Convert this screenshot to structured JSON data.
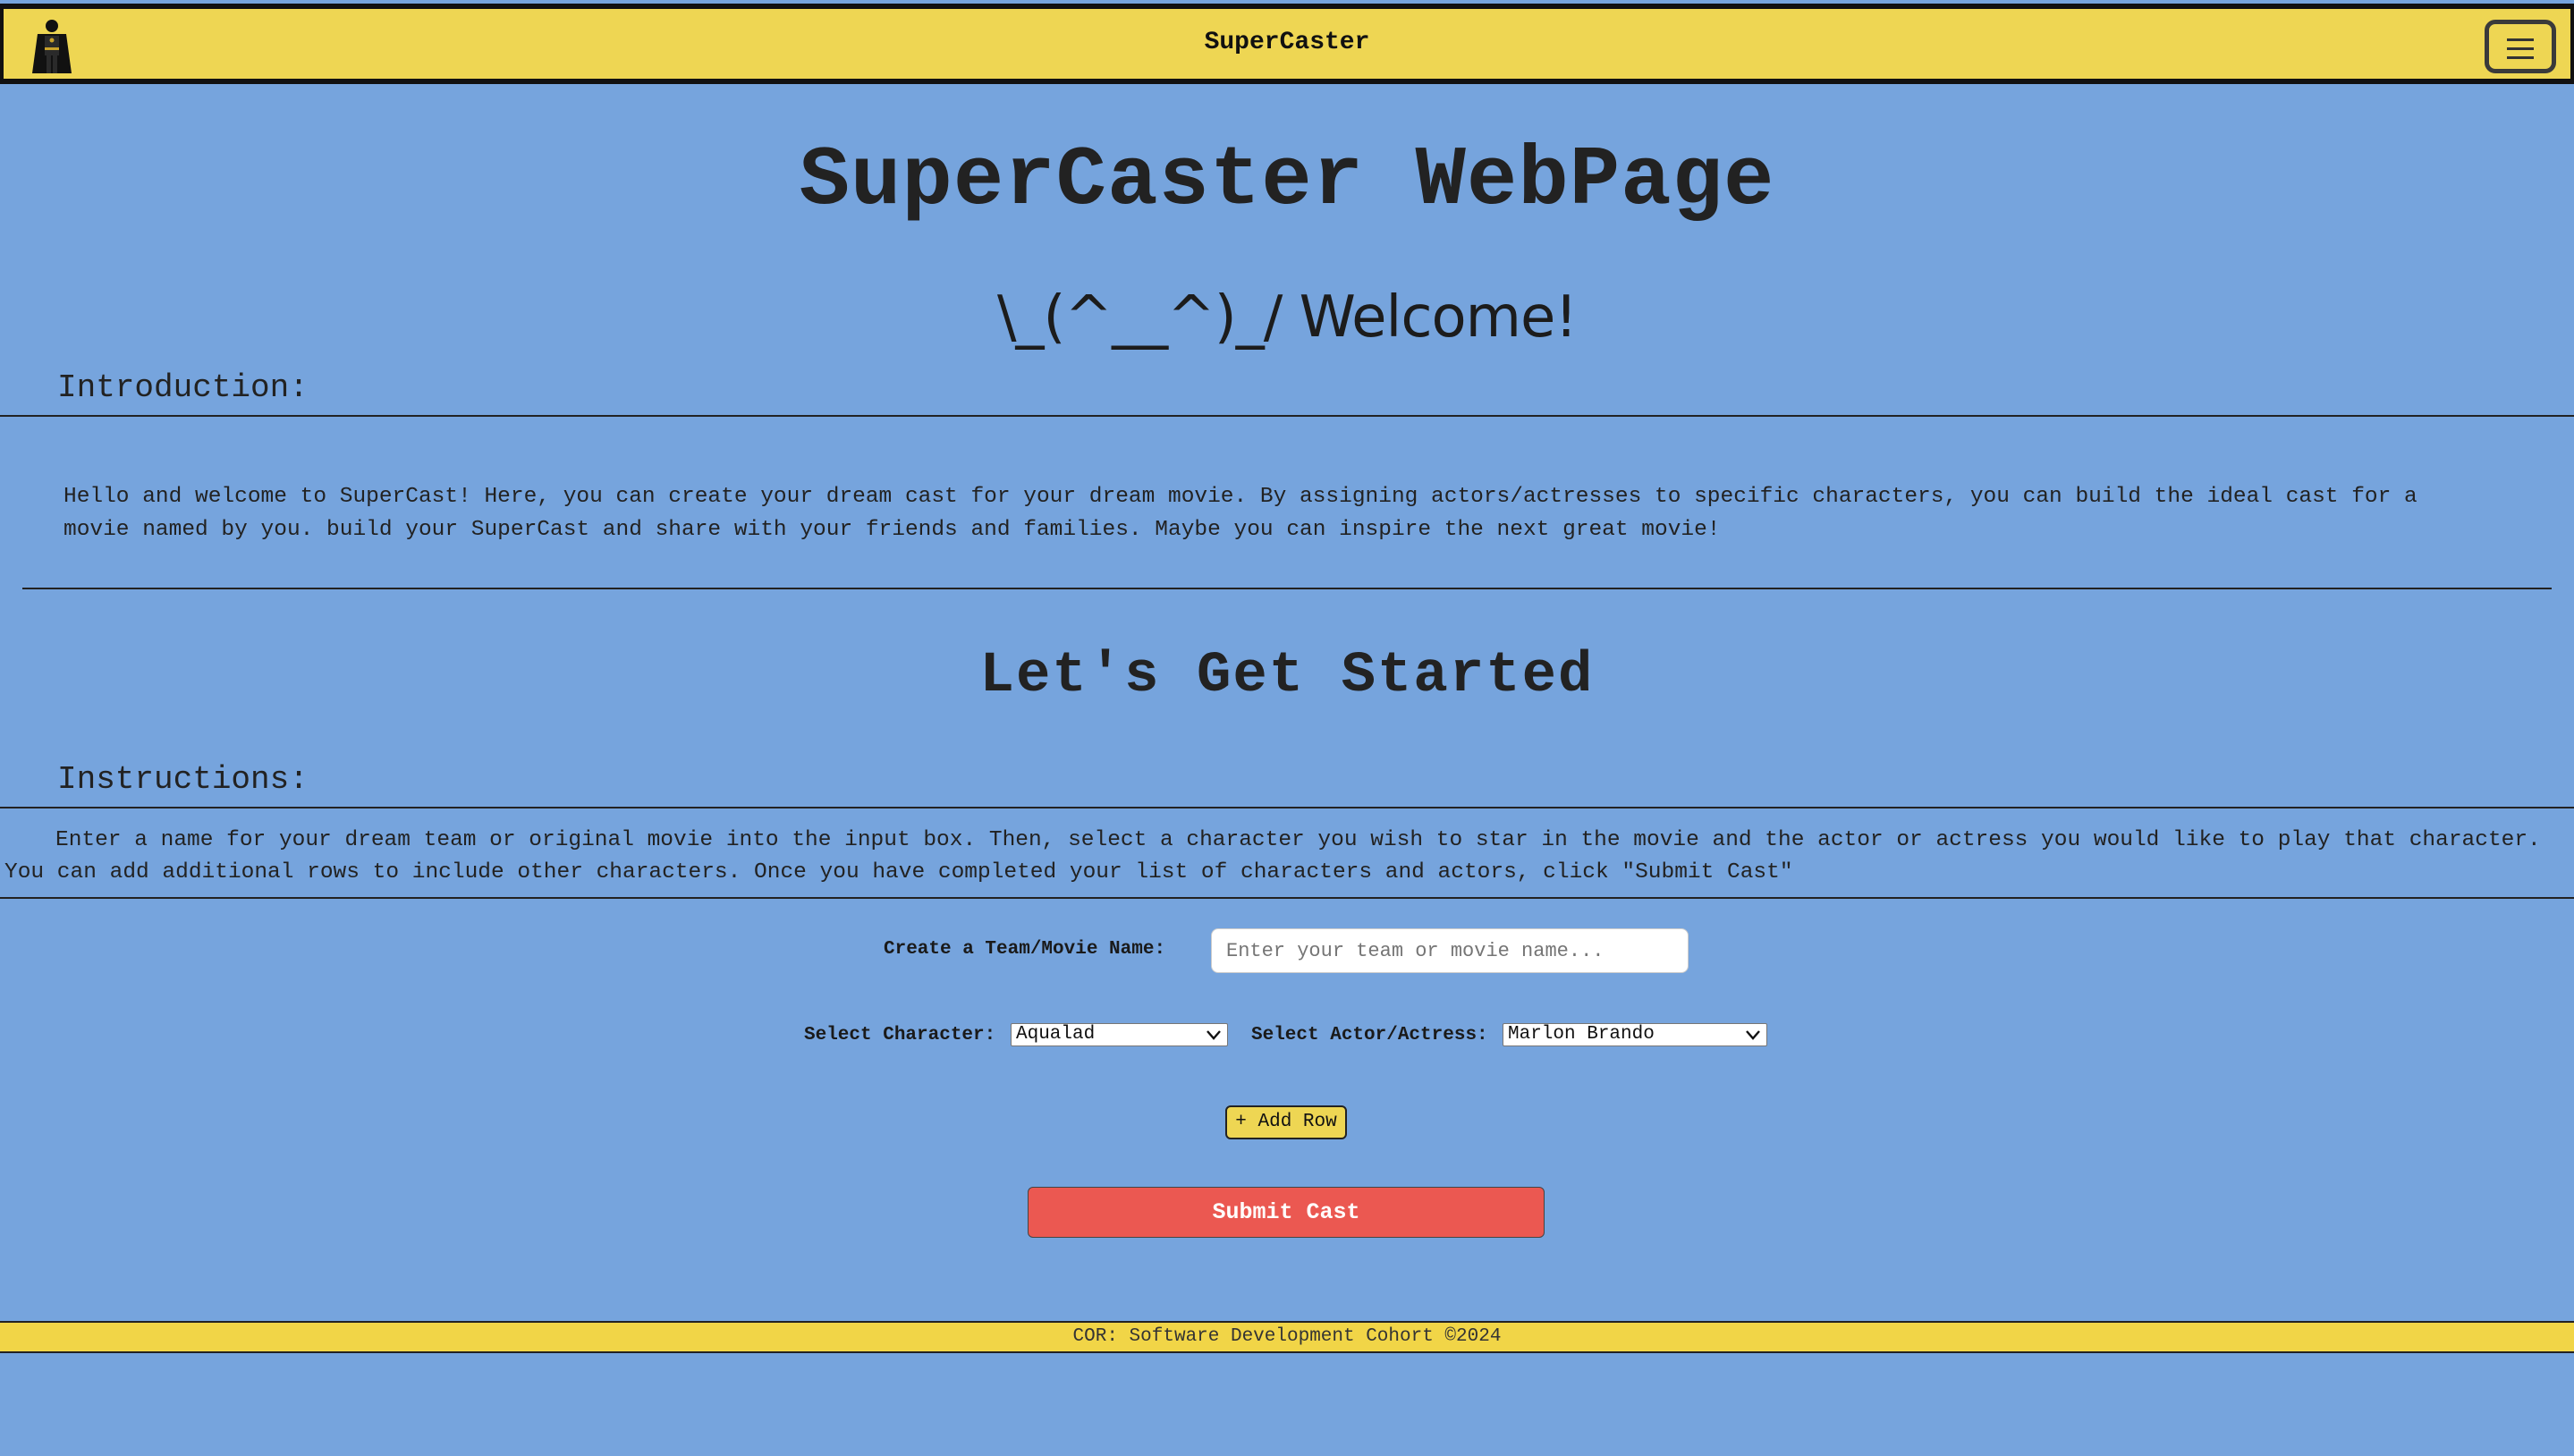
{
  "navbar": {
    "brand": "SuperCaster",
    "logo_icon": "caped-hero-icon",
    "menu_icon": "hamburger-menu-icon"
  },
  "header": {
    "title": "SuperCaster WebPage",
    "welcome": "\\_(^__^)_/ Welcome!"
  },
  "introduction": {
    "heading": "Introduction:",
    "text": "Hello and welcome to SuperCast! Here, you can create your dream cast for your dream movie. By assigning actors/actresses to specific characters, you can build the ideal cast for a movie named by you. build your SuperCast and share with your friends and families. Maybe you can inspire the next great movie!"
  },
  "getting_started": {
    "title": "Let's Get Started"
  },
  "instructions": {
    "heading": "Instructions:",
    "text": "Enter a name for your dream team or original movie into the input box. Then, select a character you wish to star in the movie and the actor or actress you would like to play that character. You can add additional rows to include other characters. Once you have completed your list of characters and actors, click \"Submit Cast\""
  },
  "form": {
    "team_label": "Create a Team/Movie Name:",
    "team_value": "",
    "team_placeholder": "Enter your team or movie name...",
    "character_label": "Select Character:",
    "character_selected": "Aqualad",
    "actor_label": "Select Actor/Actress:",
    "actor_selected": "Marlon Brando",
    "add_row_label": "+ Add Row",
    "submit_label": "Submit Cast"
  },
  "footer": {
    "text": "COR: Software Development Cohort ©2024"
  },
  "colors": {
    "background": "#76a4dd",
    "navbar": "#eed653",
    "footer": "#f1d547",
    "add_row_button": "#eed653",
    "submit_button": "#eb5851"
  }
}
